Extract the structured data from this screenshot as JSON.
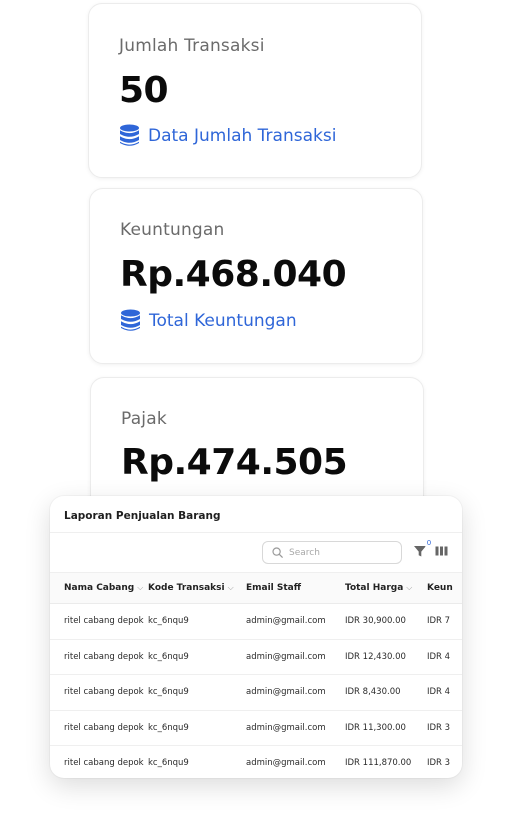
{
  "stats": [
    {
      "title": "Jumlah Transaksi",
      "value": "50",
      "link_label": "Data Jumlah Transaksi",
      "link_icon": "database-icon"
    },
    {
      "title": "Keuntungan",
      "value": "Rp.468.040",
      "link_label": "Total Keuntungan",
      "link_icon": "database-icon"
    },
    {
      "title": "Pajak",
      "value": "Rp.474.505"
    }
  ],
  "report": {
    "title": "Laporan Penjualan Barang",
    "search_placeholder": "Search",
    "filter_count": "0",
    "columns": [
      "Nama Cabang",
      "Kode Transaksi",
      "Email Staff",
      "Total Harga",
      "Keun"
    ],
    "rows": [
      [
        "ritel cabang depok",
        "kc_6nqu9",
        "admin@gmail.com",
        "IDR 30,900.00",
        "IDR 7"
      ],
      [
        "ritel cabang depok",
        "kc_6nqu9",
        "admin@gmail.com",
        "IDR 12,430.00",
        "IDR 4"
      ],
      [
        "ritel cabang depok",
        "kc_6nqu9",
        "admin@gmail.com",
        "IDR 8,430.00",
        "IDR 4"
      ],
      [
        "ritel cabang depok",
        "kc_6nqu9",
        "admin@gmail.com",
        "IDR 11,300.00",
        "IDR 3"
      ],
      [
        "ritel cabang depok",
        "kc_6nqu9",
        "admin@gmail.com",
        "IDR 111,870.00",
        "IDR 3"
      ]
    ]
  },
  "colors": {
    "accent": "#2f66d8",
    "title_gray": "#6b6b6b",
    "value_black": "#0b0b0b"
  }
}
